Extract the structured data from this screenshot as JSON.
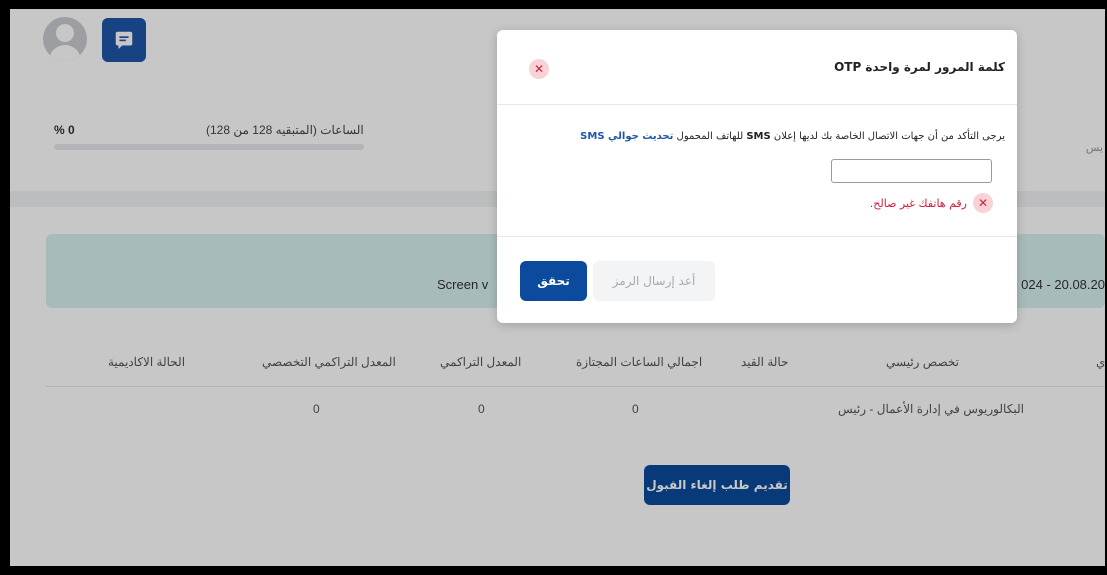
{
  "summary": {
    "percent": "% 0",
    "hours_label": "الساعات (المتبقيه 128 من 128)",
    "right_cut_text": "يس"
  },
  "banner": {
    "screen_text": "Screen v",
    "date_range": "024 - 20.08.20"
  },
  "table": {
    "headers": {
      "academic_status": "الحالة الاكاديمية",
      "major_cgpa": "المعدل التراكمي التخصصي",
      "cgpa": "المعدل التراكمي",
      "passed_hours": "اجمالي الساعات المجتازة",
      "enrollment_status": "حالة القيد",
      "main_major": "تخصص رئيسي",
      "cut_col": "ي"
    },
    "row": {
      "major_cgpa": "0",
      "cgpa": "0",
      "passed_hours": "0",
      "main_major": "البكالوريوس في إدارة الأعمال - رئيس"
    }
  },
  "cancel_admission_label": "تقديم طلب إلغاء القبول",
  "modal": {
    "title": "كلمة المرور لمرة واحدة OTP",
    "close_glyph": "✕",
    "msg_part1": "يرجى التأكد من أن جهات الاتصال الخاصة بك لديها إعلان",
    "msg_sms": "SMS",
    "msg_part2": "للهاتف المحمول",
    "msg_link": "تحديث جوالي SMS",
    "phone_value": "",
    "error_text": "رقم هاتفك غير صالح.",
    "error_glyph": "✕",
    "verify_label": "تحقق",
    "resend_label": "أعد إرسال الرمز"
  },
  "colors": {
    "primary": "#0b4a9c",
    "error": "#d81b3c",
    "banner": "#d8f0f0"
  }
}
